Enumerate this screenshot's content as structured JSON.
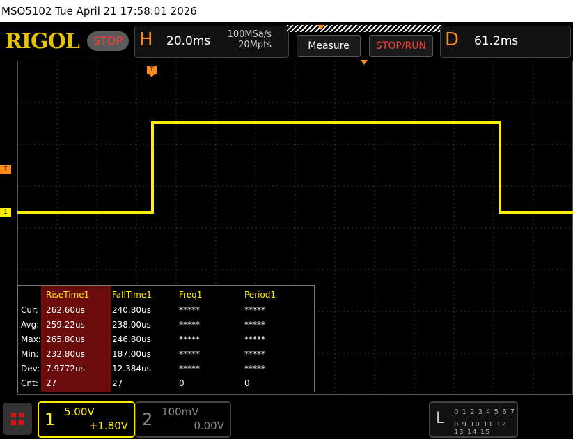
{
  "titlebar": {
    "text": "MSO5102  Tue April 21 17:58:01 2026"
  },
  "header": {
    "logo": "RIGOL",
    "status": "STOP",
    "horizontal": {
      "letter": "H",
      "timebase": "20.0ms",
      "sample_rate": "100MSa/s",
      "memory_depth": "20Mpts"
    },
    "measure_label": "Measure",
    "stoprun_label": "STOP/RUN",
    "delay": {
      "letter": "D",
      "value": "61.2ms"
    }
  },
  "markers": {
    "trigger_top": "T",
    "trigger_level": "T",
    "channel1": "1"
  },
  "waveform": {
    "channel": "1",
    "color": "#ffec00",
    "levels": [
      "low",
      "high",
      "low"
    ],
    "points": [
      {
        "t": 0.0,
        "level": "low"
      },
      {
        "t": 0.243,
        "level": "low"
      },
      {
        "t": 0.243,
        "level": "high"
      },
      {
        "t": 0.868,
        "level": "high"
      },
      {
        "t": 0.868,
        "level": "low"
      },
      {
        "t": 1.0,
        "level": "low"
      }
    ]
  },
  "measurements": {
    "columns": [
      "RiseTime1",
      "FallTime1",
      "Freq1",
      "Period1"
    ],
    "rows": [
      {
        "label": "Cur:",
        "values": [
          "262.60us",
          "240.80us",
          "*****",
          "*****"
        ]
      },
      {
        "label": "Avg:",
        "values": [
          "259.22us",
          "238.00us",
          "*****",
          "*****"
        ]
      },
      {
        "label": "Max:",
        "values": [
          "265.80us",
          "246.80us",
          "*****",
          "*****"
        ]
      },
      {
        "label": "Min:",
        "values": [
          "232.80us",
          "187.00us",
          "*****",
          "*****"
        ]
      },
      {
        "label": "Dev:",
        "values": [
          "7.9772us",
          "12.384us",
          "*****",
          "*****"
        ]
      },
      {
        "label": "Cnt:",
        "values": [
          "27",
          "27",
          "0",
          "0"
        ]
      }
    ]
  },
  "channels": {
    "ch1": {
      "number": "1",
      "scale": "5.00V",
      "offset": "+1.80V",
      "color": "#ffec00"
    },
    "ch2": {
      "number": "2",
      "scale": "100mV",
      "offset": "0.00V",
      "color": "#888888"
    }
  },
  "logic": {
    "label": "L",
    "row1": "0 1 2 3  4 5 6 7",
    "row2": "8 9 10 11 12 13 14 15"
  }
}
